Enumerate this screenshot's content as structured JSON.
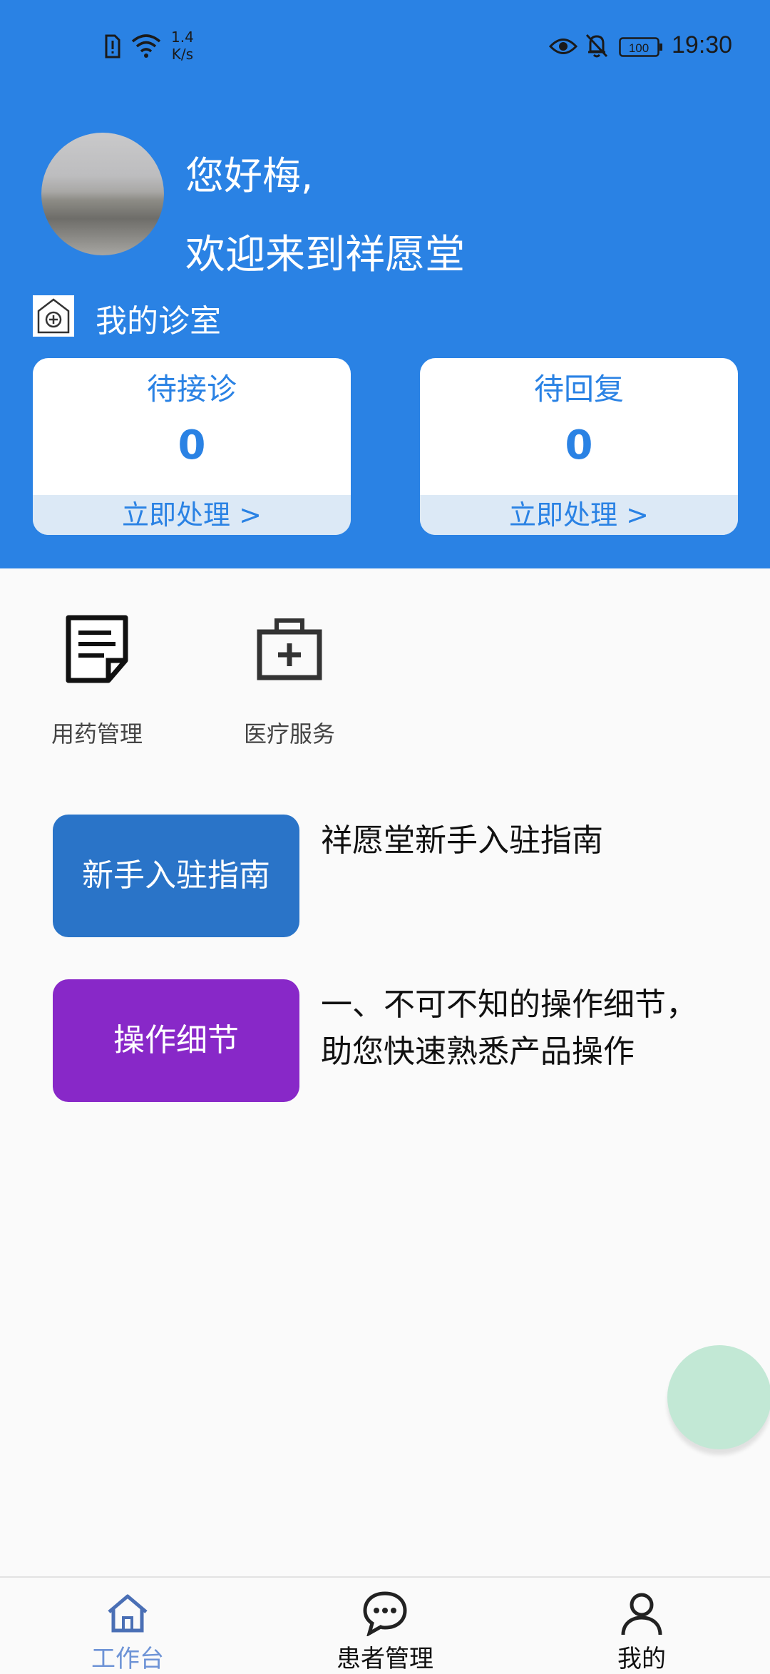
{
  "status_bar": {
    "net_speed_value": "1.4",
    "net_speed_unit": "K/s",
    "battery": "100",
    "time": "19:30"
  },
  "header": {
    "greeting": "您好梅,",
    "welcome": "欢迎来到祥愿堂",
    "clinic_label": "我的诊室",
    "background_color": "#2a82e4"
  },
  "cards": [
    {
      "title": "待接诊",
      "count": "0",
      "action": "立即处理 >"
    },
    {
      "title": "待回复",
      "count": "0",
      "action": "立即处理 >"
    }
  ],
  "tools": [
    {
      "label": "用药管理",
      "icon": "document-icon"
    },
    {
      "label": "医疗服务",
      "icon": "medical-kit-icon"
    }
  ],
  "guides": [
    {
      "button": "新手入驻指南",
      "text": "祥愿堂新手入驻指南",
      "color": "#2a74c8"
    },
    {
      "button": "操作细节",
      "text": "一、不可不知的操作细节，助您快速熟悉产品操作",
      "color": "#8828c8"
    }
  ],
  "bottom_nav": [
    {
      "label": "工作台",
      "icon": "home-icon",
      "active": true
    },
    {
      "label": "患者管理",
      "icon": "chat-icon",
      "active": false
    },
    {
      "label": "我的",
      "icon": "person-icon",
      "active": false
    }
  ]
}
